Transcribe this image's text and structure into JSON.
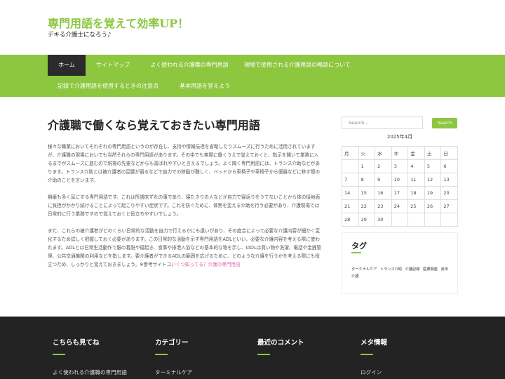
{
  "site": {
    "title": "専門用語を覚えて効率UP！",
    "description": "デキる介護士になろう♪"
  },
  "nav": {
    "items": [
      {
        "label": "ホーム"
      },
      {
        "label": "サイトマップ"
      },
      {
        "label": "よく使われる介護職の専門用語"
      },
      {
        "label": "現場で使用される介護用語の略語について"
      },
      {
        "label": "記録で介護用語を使用するときの注意点"
      },
      {
        "label": "基本用語を覚えよう"
      }
    ]
  },
  "post": {
    "title": "介護職で働くなら覚えておきたい専門用語",
    "paragraphs": [
      "様々な職業においてそれぞれの専門用語というのが存在し、支持や情報伝達を省略したりスムーズに行うために活用されていますが、介護職の現場においても当然それらの専門用語があります。その中でも実際に働くうえで覚えておくと、指示を聞いて業務に入るまでがスムーズに進むので現場の先輩などからも喜ばれやすいと言えるでしょう。よく聞く専門用語には、トランス介助などがあります。トランス介助とは被介護者の足腰が弱るなどで自力での移動が難しく、ベッドから車椅子や車椅子から便器などに移す際の介助のことを言います。",
      "褥瘡も多く耳にする専門用語です。これは所謂床ずれの事であり、寝たきりの人などが自力で寝返りをうてないことから体の接地面に負担がかかり続けることによって起こりやすい症状です。これを防ぐために、体勢を変える介助を行う必要があり、介護現場では日常的に行う業務ですので覚えておくと役立ちやすいでしょう。"
    ],
    "para3_text": "また、これらの被介護者がどのくらい日常的な活動を自力で行えるかにも違いがあり、その度合によって必要な介護内容が細かく変化するため詳しく把握しておく必要があります。この日常的な活動を示す専門用語をADLといい、必要な介護内容を考える際に使われます。ADLとは日常生活動作で服の着脱や寝起き、食事や排泄入浴などの基本的な物を示し、IADLは買い物や洗濯、電話や金銭管理、公共交通機関の利用などを指します。要介護者ができるADLの範囲を広げるために、どのような介護を行うかを考える際にも役立つため、しっかりと覚えておきましょう。※参考サイトコ",
    "para3_link": "いくつ知ってる？介護の専門用語"
  },
  "sidebar": {
    "search_placeholder": "Search...",
    "search_button": "Search",
    "calendar": {
      "caption": "2025年4月",
      "headers": [
        "月",
        "火",
        "水",
        "木",
        "金",
        "土",
        "日"
      ],
      "rows": [
        [
          "",
          "1",
          "2",
          "3",
          "4",
          "5",
          "6"
        ],
        [
          "7",
          "8",
          "9",
          "10",
          "11",
          "12",
          "13"
        ],
        [
          "14",
          "15",
          "16",
          "17",
          "18",
          "19",
          "20"
        ],
        [
          "21",
          "22",
          "23",
          "24",
          "25",
          "26",
          "27"
        ],
        [
          "28",
          "29",
          "30",
          "",
          "",
          "",
          ""
        ]
      ]
    },
    "tags_title": "タグ",
    "tags": [
      "ターミナルケア",
      "トランス介助",
      "介護記録",
      "医療関連",
      "身体介護"
    ]
  },
  "footer": {
    "columns": [
      {
        "title": "こちらも見てね",
        "item": "よく使われる介護職の専門用語"
      },
      {
        "title": "カテゴリー",
        "item": "ターミナルケア"
      },
      {
        "title": "最近のコメント",
        "item": ""
      },
      {
        "title": "メタ情報",
        "item": "ログイン"
      }
    ]
  },
  "colors": {
    "accent": "#8dc63f",
    "nav_active": "#2b2b2b",
    "footer_bg": "#232323",
    "link": "#e85fa0"
  }
}
